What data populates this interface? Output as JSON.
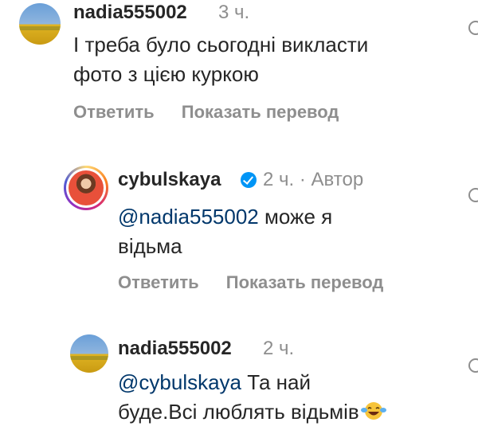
{
  "comments": [
    {
      "username": "nadia555002",
      "time": "3 ч.",
      "text_lines": [
        "І треба було сьогодні викласти",
        "фото з цією куркою"
      ],
      "reply": "Ответить",
      "translate": "Показать перевод"
    },
    {
      "username": "cybulskaya",
      "time": "2 ч. · Автор",
      "mention": "@nadia555002",
      "text_line1": " може я",
      "text_line2": "відьма",
      "reply": "Ответить",
      "translate": "Показать перевод"
    },
    {
      "username": "nadia555002",
      "time": "2 ч.",
      "mention": "@cybulskaya",
      "text_line1": " Та най",
      "text_line2": "буде.Всі люблять відьмів",
      "emoji": "laughing-with-tears-emoji"
    }
  ]
}
